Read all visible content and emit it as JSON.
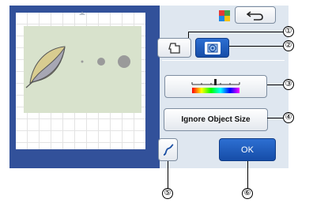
{
  "controls": {
    "ignore_object_size_label": "Ignore Object Size",
    "ok_label": "OK"
  },
  "callouts": [
    "①",
    "②",
    "③",
    "④",
    "⑤",
    "⑥"
  ],
  "icons": {
    "back": "back-arrow-icon",
    "color_mode": "color-grid-icon",
    "outline_mode": "outline-shape-icon",
    "background_mode": "fill-background-icon",
    "threshold": "threshold-slider-icon",
    "curve": "curve-icon"
  },
  "colors": {
    "accent_blue": "#2d6fd2",
    "preview_frame": "#32519a",
    "panel_bg": "#dfe7f0"
  }
}
